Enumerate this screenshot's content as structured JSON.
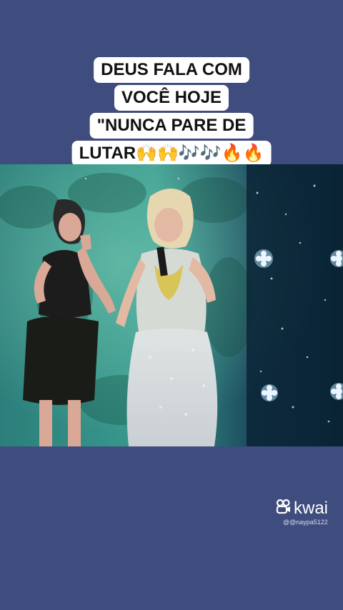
{
  "caption": {
    "line1": "DEUS FALA COM",
    "line2": "VOCÊ HOJE",
    "line3": "\"NUNCA PARE DE",
    "line4": "LUTAR🙌🙌🎶🎶🔥🔥"
  },
  "watermark": {
    "icon": "kwai-camera-icon",
    "brand": "kwai",
    "username": "@@naypa5122"
  },
  "colors": {
    "background": "#3f4c7e",
    "caption_bg": "#ffffff",
    "caption_text": "#111111",
    "stage_teal": "#2f8a86",
    "stage_dark": "#0d2a3a"
  }
}
